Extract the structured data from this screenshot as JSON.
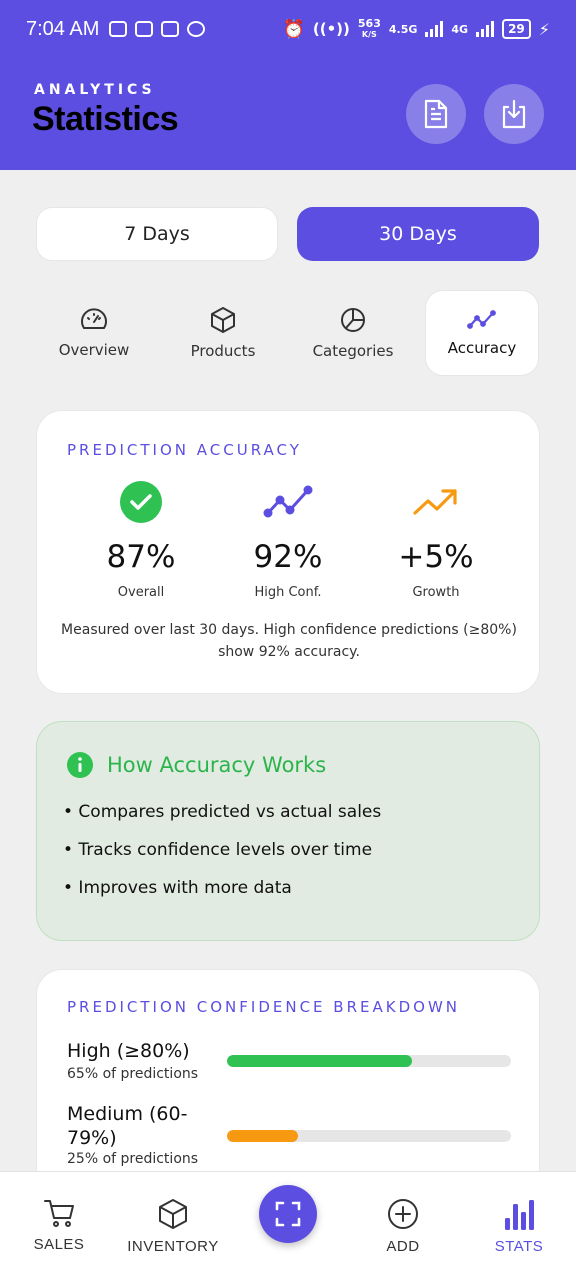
{
  "status_bar": {
    "time": "7:04 AM",
    "net_speed": "563",
    "net_unit": "K/S",
    "net_type_1": "4.5G",
    "net_type_2": "4G",
    "battery": "29"
  },
  "header": {
    "eyebrow": "ANALYTICS",
    "title": "Statistics",
    "report_icon": "document-icon",
    "download_icon": "download-icon"
  },
  "range": {
    "options": [
      "7 Days",
      "30 Days"
    ],
    "selected": "30 Days"
  },
  "tabs": [
    {
      "label": "Overview",
      "icon": "gauge-icon"
    },
    {
      "label": "Products",
      "icon": "box-icon"
    },
    {
      "label": "Categories",
      "icon": "pie-icon"
    },
    {
      "label": "Accuracy",
      "icon": "trend-line-icon"
    }
  ],
  "active_tab": "Accuracy",
  "accuracy_card": {
    "label": "PREDICTION ACCURACY",
    "metrics": [
      {
        "value": "87%",
        "label": "Overall",
        "icon": "check-circle-icon"
      },
      {
        "value": "92%",
        "label": "High Conf.",
        "icon": "trend-line-icon"
      },
      {
        "value": "+5%",
        "label": "Growth",
        "icon": "trending-up-icon"
      }
    ],
    "note": "Measured over last 30 days. High confidence predictions (≥80%) show 92% accuracy."
  },
  "info_card": {
    "title": "How Accuracy Works",
    "icon": "info-icon",
    "bullets": [
      "• Compares predicted vs actual sales",
      "• Tracks confidence levels over time",
      "• Improves with more data"
    ]
  },
  "breakdown": {
    "label": "PREDICTION CONFIDENCE BREAKDOWN",
    "rows": [
      {
        "label": "High (≥80%)",
        "sub": "65% of predictions",
        "percent": 65,
        "color": "#2fc152"
      },
      {
        "label": "Medium (60-79%)",
        "sub": "25% of predictions",
        "percent": 25,
        "color": "#f79a12"
      }
    ]
  },
  "nav": [
    {
      "label": "SALES",
      "icon": "cart-icon"
    },
    {
      "label": "INVENTORY",
      "icon": "box-icon"
    },
    {
      "label": "",
      "icon": "scan-icon"
    },
    {
      "label": "ADD",
      "icon": "plus-circle-icon"
    },
    {
      "label": "STATS",
      "icon": "bar-chart-icon"
    }
  ],
  "colors": {
    "accent": "#5b4ee0",
    "success": "#2fc152",
    "warning": "#f79a12"
  }
}
